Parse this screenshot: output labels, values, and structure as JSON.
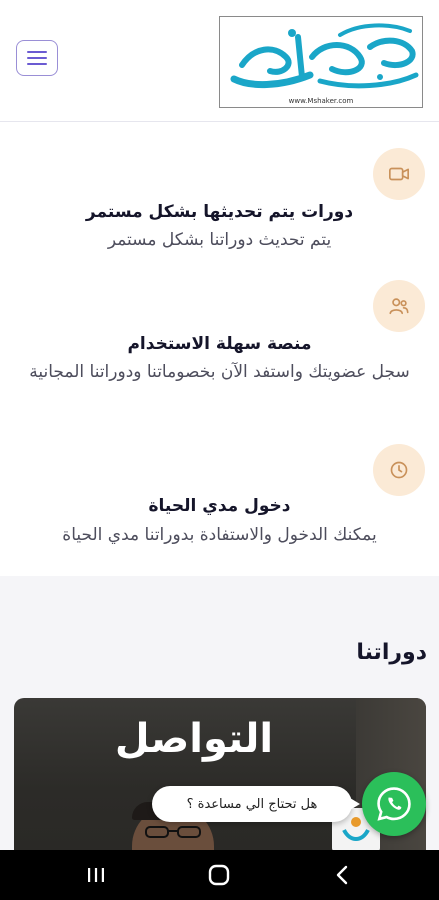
{
  "header": {
    "logo_url_text": "www.Mshaker.com",
    "logo_alt": "محمد شاكر"
  },
  "features": [
    {
      "icon": "video-icon",
      "title": "دورات يتم تحديثها بشكل مستمر",
      "description": "يتم تحديث دوراتنا بشكل مستمر"
    },
    {
      "icon": "users-icon",
      "title": "منصة سهلة الاستخدام",
      "description": "سجل عضويتك واستفد الآن بخصوماتنا ودوراتنا المجانية"
    },
    {
      "icon": "clock-icon",
      "title": "دخول مدي الحياة",
      "description": "يمكنك الدخول والاستفادة بدوراتنا مدي الحياة"
    }
  ],
  "courses": {
    "title": "دوراتنا",
    "cards": [
      {
        "title": "التواصل"
      }
    ]
  },
  "help": {
    "text": "هل تحتاج الي مساعدة ؟"
  },
  "colors": {
    "accent": "#6b5bd2",
    "icon_bg": "#fbead6",
    "icon_stroke": "#c9915a",
    "whatsapp": "#2bbf5a"
  }
}
